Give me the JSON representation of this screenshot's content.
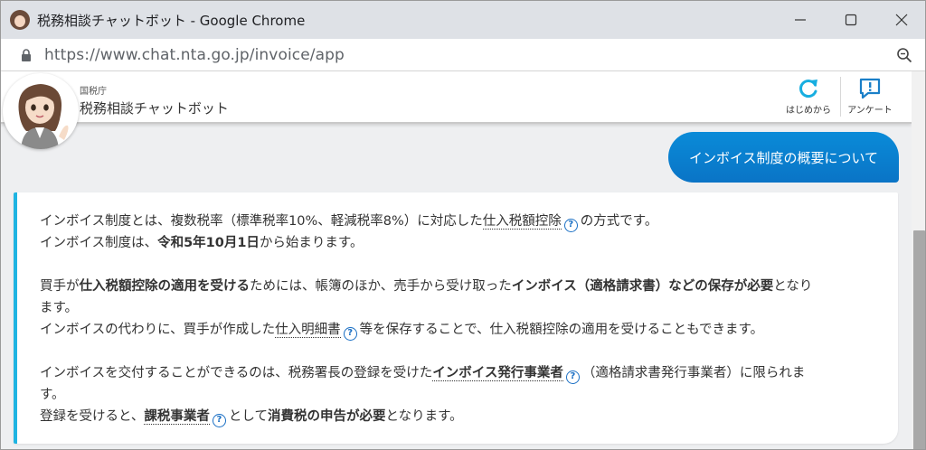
{
  "browser": {
    "window_title": "税務相談チャットボット - Google Chrome",
    "url": "https://www.chat.nta.go.jp/invoice/app",
    "icons": {
      "favicon": "chatbot-avatar-icon",
      "lock": "lock-icon",
      "zoom": "zoom-icon",
      "minimize": "minimize-icon",
      "maximize": "maximize-icon",
      "close": "close-icon"
    }
  },
  "header": {
    "agency": "国税庁",
    "title": "税務相談チャットボット",
    "restart_label": "はじめから",
    "survey_label": "アンケート",
    "accent_color": "#0a8bd8"
  },
  "chat": {
    "user_message": "インボイス制度の概要について",
    "bot_message": {
      "l1a": "インボイス制度とは、複数税率（標準税率10%、軽減税率8%）に対応した",
      "l1_link": "仕入税額控除",
      "l1b": "の方式です。",
      "l2a": "インボイス制度は、",
      "l2_bold": "令和5年10月1日",
      "l2b": "から始まります。",
      "l3a": "買手が",
      "l3_bold": "仕入税額控除の適用を受ける",
      "l3b": "ためには、帳簿のほか、売手から受け取った",
      "l3_bold2": "インボイス（適格請求書）などの保存が必要",
      "l3c": "となり",
      "l4": "ます。",
      "l5a": "インボイスの代わりに、買手が作成した",
      "l5_link": "仕入明細書",
      "l5b": "等を保存することで、仕入税額控除の適用を受けることもできます。",
      "l6a": "インボイスを交付することができるのは、税務署長の登録を受けた",
      "l6_link": "インボイス発行事業者",
      "l6b": "（適格請求書発行事業者）に限られま",
      "l7": "す。",
      "l8a": "登録を受けると、",
      "l8_link": "課税事業者",
      "l8b": "として",
      "l8_bold": "消費税の申告が必要",
      "l8c": "となります。",
      "help_glyph": "?"
    }
  }
}
